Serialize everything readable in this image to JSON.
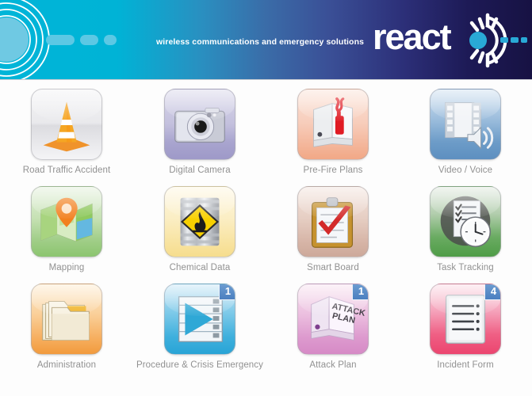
{
  "header": {
    "tagline": "wireless communications and emergency solutions",
    "brand": "react",
    "brand_mark_icon": "radiating-sun-signal-icon",
    "waves_icon": "concentric-signal-waves-icon",
    "dashes_icon": "three-dashes-icon",
    "colors": {
      "gradient_start": "#00b5d8",
      "gradient_end": "#171243",
      "dash": "#5cc8e4",
      "text": "#ffffff"
    }
  },
  "grid": {
    "label_color": "#919191",
    "background": "#fdfdfd",
    "badge_color": "#4b7fc0",
    "items": [
      {
        "label": "Road Traffic Accident",
        "icon": "traffic-cone-icon",
        "tile_class": "bg-gray",
        "badge": null
      },
      {
        "label": "Digital Camera",
        "icon": "camera-icon",
        "tile_class": "bg-purple",
        "badge": null
      },
      {
        "label": "Pre-Fire Plans",
        "icon": "book-fire-extinguisher-icon",
        "tile_class": "bg-salmon",
        "badge": null
      },
      {
        "label": "Video / Voice",
        "icon": "film-speaker-icon",
        "tile_class": "bg-blue",
        "badge": null
      },
      {
        "label": "Mapping",
        "icon": "map-pin-icon",
        "tile_class": "bg-green",
        "badge": null
      },
      {
        "label": "Chemical Data",
        "icon": "hazard-barrel-icon",
        "tile_class": "bg-yellow",
        "badge": null
      },
      {
        "label": "Smart Board",
        "icon": "clipboard-check-icon",
        "tile_class": "bg-beige",
        "badge": null
      },
      {
        "label": "Task Tracking",
        "icon": "checklist-clock-icon",
        "tile_class": "bg-darkgreen",
        "badge": null
      },
      {
        "label": "Administration",
        "icon": "file-folders-icon",
        "tile_class": "bg-orange",
        "badge": null
      },
      {
        "label": "Procedure & Crisis Emergency",
        "icon": "play-list-icon",
        "tile_class": "bg-cyan",
        "badge": "1"
      },
      {
        "label": "Attack Plan",
        "icon": "attack-plan-book-icon",
        "tile_class": "bg-pink",
        "badge": "1"
      },
      {
        "label": "Incident Form",
        "icon": "form-document-icon",
        "tile_class": "bg-crimson",
        "badge": "4"
      }
    ]
  }
}
